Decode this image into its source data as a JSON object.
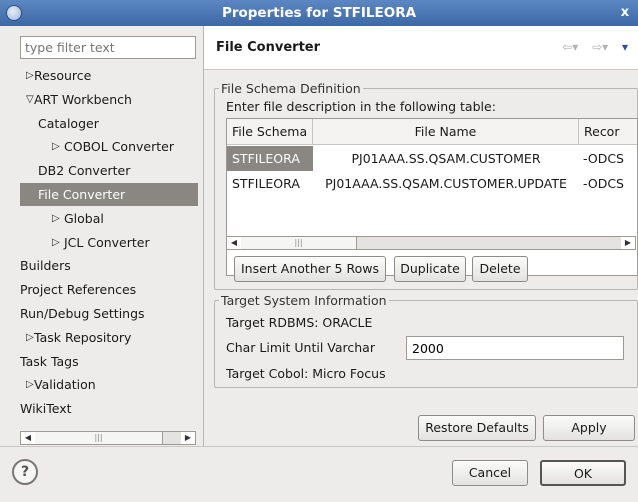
{
  "window": {
    "title": "Properties for STFILEORA",
    "close_label": "x"
  },
  "filter": {
    "placeholder": "type filter text"
  },
  "tree": [
    {
      "label": "Resource",
      "level": 0,
      "expandable": true,
      "expanded": false
    },
    {
      "label": "ART Workbench",
      "level": 0,
      "expandable": true,
      "expanded": true
    },
    {
      "label": "Cataloger",
      "level": 1,
      "expandable": false
    },
    {
      "label": "COBOL Converter",
      "level": 1,
      "expandable": true,
      "expanded": false
    },
    {
      "label": "DB2 Converter",
      "level": 1,
      "expandable": false
    },
    {
      "label": "File Converter",
      "level": 1,
      "expandable": false,
      "selected": true
    },
    {
      "label": "Global",
      "level": 1,
      "expandable": true,
      "expanded": false
    },
    {
      "label": "JCL Converter",
      "level": 1,
      "expandable": true,
      "expanded": false
    },
    {
      "label": "Builders",
      "level": 0,
      "expandable": false
    },
    {
      "label": "Project References",
      "level": 0,
      "expandable": false
    },
    {
      "label": "Run/Debug Settings",
      "level": 0,
      "expandable": false
    },
    {
      "label": "Task Repository",
      "level": 0,
      "expandable": true,
      "expanded": false
    },
    {
      "label": "Task Tags",
      "level": 0,
      "expandable": false
    },
    {
      "label": "Validation",
      "level": 0,
      "expandable": true,
      "expanded": false
    },
    {
      "label": "WikiText",
      "level": 0,
      "expandable": false
    }
  ],
  "page": {
    "title": "File Converter",
    "back_icon": "⇦▾",
    "forward_icon": "⇨▾",
    "menu_icon": "▾"
  },
  "schema": {
    "group_title": "File Schema Definition",
    "instruction": "Enter file description in the following table:",
    "columns": [
      "File Schema",
      "File Name",
      "Recor"
    ],
    "rows": [
      [
        "STFILEORA",
        "PJ01AAA.SS.QSAM.CUSTOMER",
        "-ODCS"
      ],
      [
        "STFILEORA",
        "PJ01AAA.SS.QSAM.CUSTOMER.UPDATE",
        "-ODCS"
      ]
    ],
    "buttons": {
      "insert": "Insert Another 5 Rows",
      "duplicate": "Duplicate",
      "delete": "Delete"
    }
  },
  "target": {
    "group_title": "Target System Information",
    "rdbms": "Target RDBMS: ORACLE",
    "char_limit_label": "Char Limit Until Varchar",
    "char_limit_value": "2000",
    "cobol": "Target Cobol: Micro Focus"
  },
  "actions": {
    "restore": "Restore Defaults",
    "apply": "Apply",
    "cancel": "Cancel",
    "ok": "OK"
  },
  "icons": {
    "help": "?"
  }
}
